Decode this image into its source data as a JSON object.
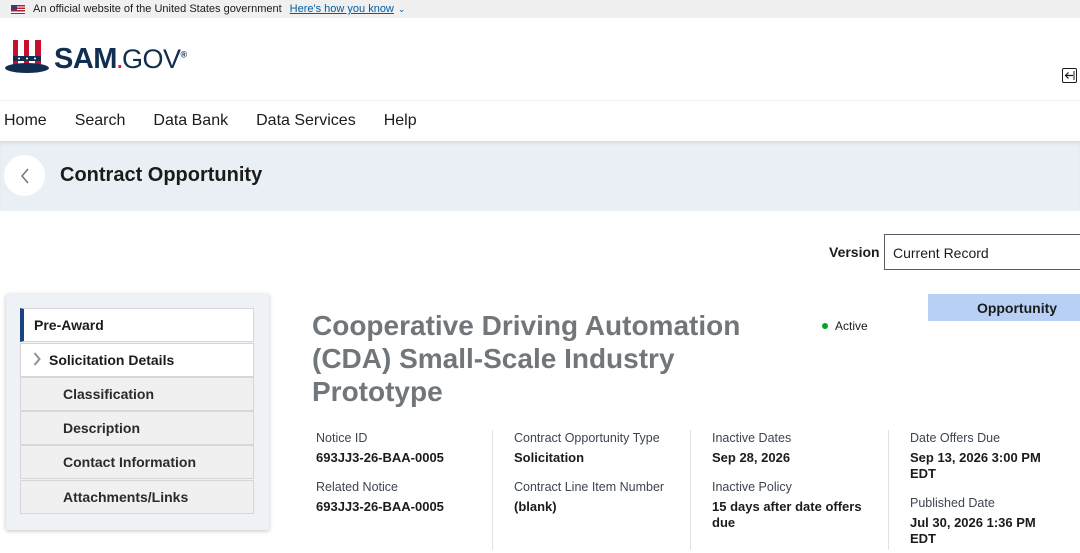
{
  "gov_banner": {
    "text": "An official website of the United States government",
    "link": "Here's how you know",
    "chevron": "⌄"
  },
  "logo": {
    "word": "SAM",
    "dot": ".",
    "gov": "GOV",
    "reg": "®"
  },
  "nav": {
    "items": [
      "Home",
      "Search",
      "Data Bank",
      "Data Services",
      "Help"
    ]
  },
  "page_header": {
    "title": "Contract Opportunity"
  },
  "version": {
    "label": "Version",
    "value": "Current Record"
  },
  "sidebar": {
    "items": [
      "Pre-Award",
      "Solicitation Details",
      "Classification",
      "Description",
      "Contact Information",
      "Attachments/Links"
    ]
  },
  "opportunity": {
    "tab": "Opportunity",
    "title": "Cooperative Driving Automation (CDA) Small-Scale Industry Prototype",
    "status": "Active",
    "status_color": "#00a91c",
    "fields": {
      "notice_id_label": "Notice ID",
      "notice_id": "693JJ3-26-BAA-0005",
      "related_notice_label": "Related Notice",
      "related_notice": "693JJ3-26-BAA-0005",
      "type_label": "Contract Opportunity Type",
      "type": "Solicitation",
      "clin_label": "Contract Line Item Number",
      "clin": "(blank)",
      "inactive_dates_label": "Inactive Dates",
      "inactive_dates": "Sep 28, 2026",
      "inactive_policy_label": "Inactive Policy",
      "inactive_policy": "15 days after date offers due",
      "offers_due_label": "Date Offers Due",
      "offers_due": "Sep 13, 2026 3:00 PM EDT",
      "published_label": "Published Date",
      "published": "Jul 30, 2026 1:36 PM EDT"
    }
  }
}
